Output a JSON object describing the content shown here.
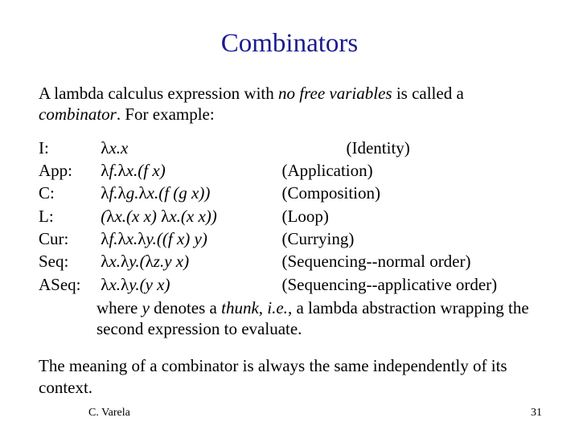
{
  "title": "Combinators",
  "intro": {
    "pre": "A lambda calculus expression with ",
    "nfv": "no free variables",
    "mid": " is called a ",
    "comb": "combinator",
    "post": ".  For example:"
  },
  "lambda": "λ",
  "rows": [
    {
      "name": "I:",
      "expr_tpl": "{L}x.x",
      "desc": "(Identity)"
    },
    {
      "name": "App:",
      "expr_tpl": "{L}f.{L}x.(f x)",
      "desc": "(Application)"
    },
    {
      "name": "C:",
      "expr_tpl": "{L}f.{L}g.{L}x.(f (g x))",
      "desc": "(Composition)"
    },
    {
      "name": "L:",
      "expr_tpl": "({L}x.(x x) {L}x.(x x))",
      "desc": "(Loop)"
    },
    {
      "name": "Cur:",
      "expr_tpl": "{L}f.{L}x.{L}y.((f x) y)",
      "desc": "(Currying)"
    },
    {
      "name": "Seq:",
      "expr_tpl": "{L}x.{L}y.({L}z.y x)",
      "desc": "(Sequencing--normal order)"
    },
    {
      "name": "ASeq:",
      "expr_tpl": "{L}x.{L}y.(y x)",
      "desc": "(Sequencing--applicative order)"
    }
  ],
  "note": {
    "pre": "where ",
    "yvar": "y",
    "mid1": " denotes a ",
    "thunk": "thunk",
    "mid2": ", ",
    "ie": "i.e.",
    "post": ", a lambda abstraction wrapping the second expression to evaluate."
  },
  "closing": "The meaning of a combinator is always the same independently of its context.",
  "footer": {
    "author": "C. Varela",
    "page": "31"
  }
}
